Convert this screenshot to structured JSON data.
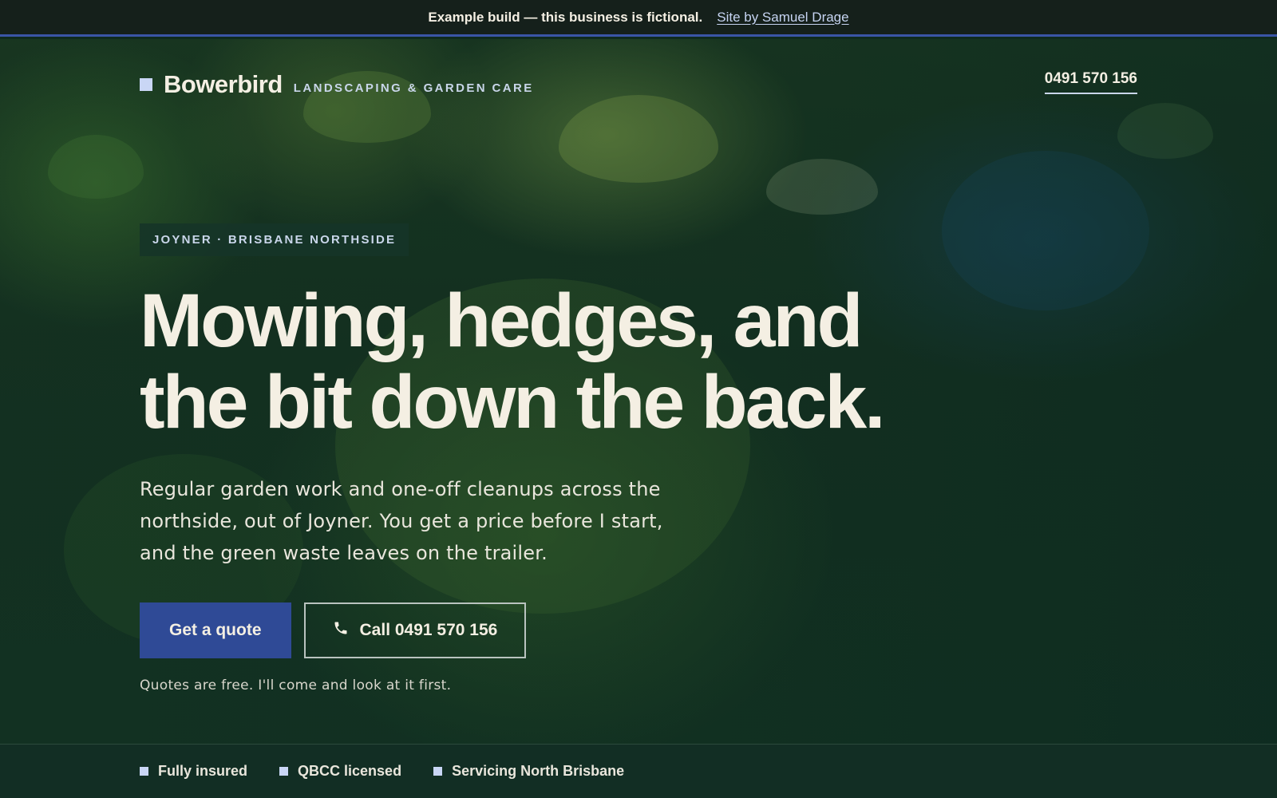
{
  "banner": {
    "note": "Example build — this business is fictional.",
    "credit": "Site by Samuel Drage"
  },
  "header": {
    "brand": "Bowerbird",
    "tagline": "LANDSCAPING & GARDEN CARE",
    "phone": "0491 570 156"
  },
  "hero": {
    "location": "JOYNER · BRISBANE NORTHSIDE",
    "headline": "Mowing, hedges, and the bit down the back.",
    "lede": "Regular garden work and one-off cleanups across the northside, out of Joyner. You get a price before I start, and the green waste leaves on the trailer.",
    "primary_cta": "Get a quote",
    "secondary_cta": "Call 0491 570 156",
    "reassurance": "Quotes are free. I'll come and look at it first."
  },
  "trust": {
    "items": [
      {
        "label": "Fully insured"
      },
      {
        "label": "QBCC licensed"
      },
      {
        "label": "Servicing North Brisbane"
      }
    ]
  },
  "colors": {
    "accent": "#2f4a96",
    "banner_rule": "#3a55a6",
    "hero_green": "#143424",
    "text_cream": "#f4efe3"
  }
}
